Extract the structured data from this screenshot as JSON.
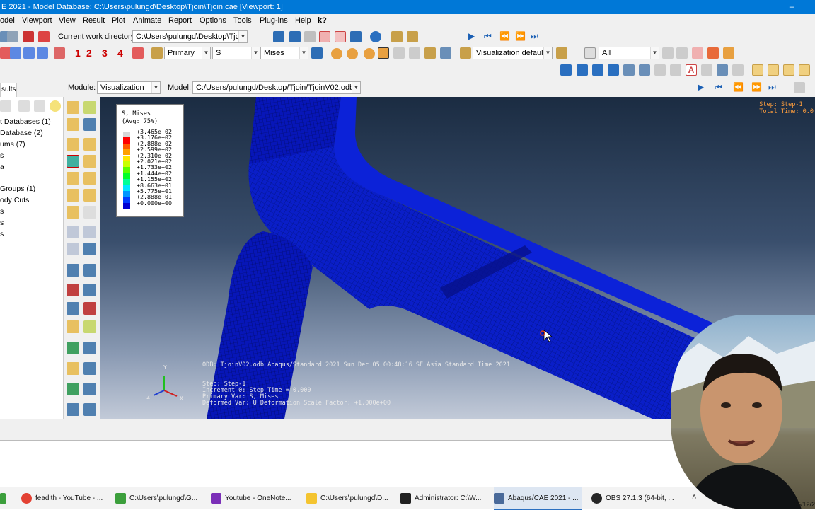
{
  "window": {
    "title": "E 2021 - Model Database: C:\\Users\\pulungd\\Desktop\\Tjoin\\Tjoin.cae [Viewport: 1]",
    "minimize_symbol": "–"
  },
  "menu": {
    "items": [
      "odel",
      "Viewport",
      "View",
      "Result",
      "Plot",
      "Animate",
      "Report",
      "Options",
      "Tools",
      "Plug-ins",
      "Help",
      "k?"
    ]
  },
  "toolbar": {
    "cwd_label": "Current work directory:",
    "cwd_value": "C:\\Users\\pulungd\\Desktop\\Tjoin",
    "step_numbers": [
      "1",
      "2",
      "3",
      "4"
    ],
    "primary_select": "Primary",
    "variable_select": "S",
    "invariant_select": "Mises",
    "view_defaults": "Visualization defaults",
    "selection_filter": "All"
  },
  "context_bar": {
    "module_label": "Module:",
    "module_value": "Visualization",
    "model_label": "Model:",
    "model_value": "C:/Users/pulungd/Desktop/Tjoin/TjoinV02.odb"
  },
  "left_panel": {
    "tab_label": "sults",
    "tree_items": [
      "t Databases (1)",
      "Database (2)",
      "ums (7)",
      "s",
      "a",
      "Groups (1)",
      "ody Cuts",
      "s",
      "s",
      "s"
    ]
  },
  "legend": {
    "title_line1": "S, Mises",
    "title_line2": "(Avg: 75%)",
    "values": [
      "+3.465e+02",
      "+3.176e+02",
      "+2.888e+02",
      "+2.599e+02",
      "+2.310e+02",
      "+2.021e+02",
      "+1.733e+02",
      "+1.444e+02",
      "+1.155e+02",
      "+8.663e+01",
      "+5.775e+01",
      "+2.888e+01",
      "+0.000e+00"
    ],
    "colors": [
      "#d7d7d7",
      "#ff0000",
      "#ff5a00",
      "#ffa000",
      "#ffe600",
      "#c8ff00",
      "#5aff00",
      "#00ff28",
      "#00ff96",
      "#00e6ff",
      "#0096ff",
      "#003cff",
      "#0000d2"
    ]
  },
  "viewport": {
    "step_line1": "Step: Step-1",
    "step_line2": "Total Time: 0.0",
    "odb_line": "ODB: TjoinV02.odb    Abaqus/Standard 2021    Sun Dec 05 00:48:16 SE Asia Standard Time 2021",
    "info_step": "Step: Step-1",
    "info_increment": "Increment     0: Step Time =    0.000",
    "info_primary": "Primary Var: S, Mises",
    "info_deformed": "Deformed Var: U   Deformation Scale Factor: +1.000e+00",
    "triad_y": "Y",
    "triad_z": "Z",
    "triad_x": "X"
  },
  "taskbar": {
    "items": [
      {
        "label": "feadith - YouTube - ...",
        "color": "#e34133"
      },
      {
        "label": "C:\\Users\\pulungd\\G...",
        "color": "#3c9f3c"
      },
      {
        "label": "Youtube - OneNote...",
        "color": "#7b2fb8"
      },
      {
        "label": "C:\\Users\\pulungd\\D...",
        "color": "#f4c430"
      },
      {
        "label": "Administrator: C:\\W...",
        "color": "#202020"
      },
      {
        "label": "Abaqus/CAE 2021 - ...",
        "color": "#4a6a9a"
      },
      {
        "label": "OBS 27.1.3 (64-bit, ...",
        "color": "#262626"
      }
    ],
    "clock_date": "05/12/2"
  }
}
